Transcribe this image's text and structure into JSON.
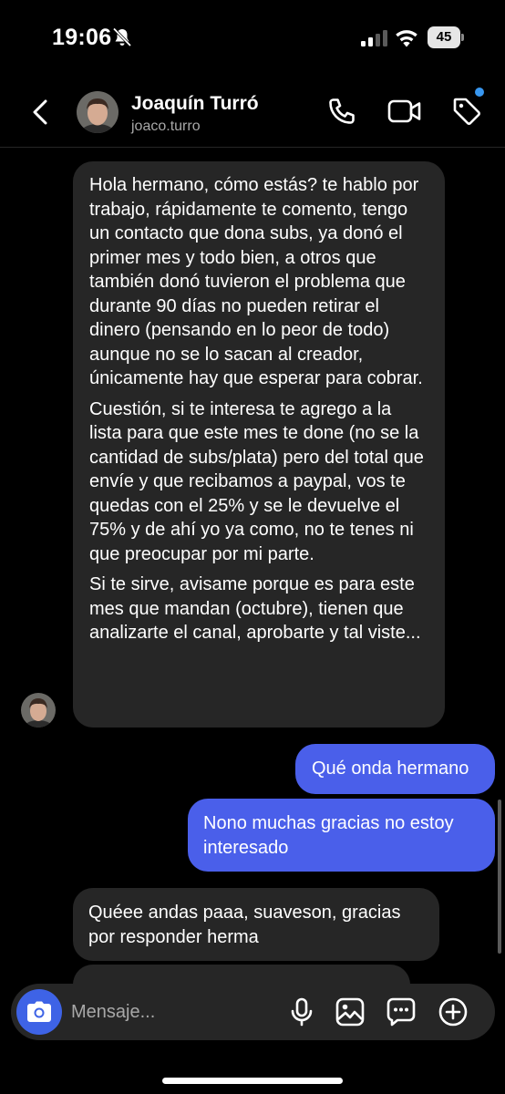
{
  "status_bar": {
    "time": "19:06",
    "battery": "45"
  },
  "header": {
    "contact_name": "Joaquín Turró",
    "username": "joaco.turro"
  },
  "messages": [
    {
      "sender": "Joaquín Turró",
      "direction": "incoming",
      "paragraphs": [
        "Hola hermano, cómo estás? te hablo por trabajo, rápidamente te comento, tengo un contacto que dona subs, ya donó el primer mes y todo bien, a otros que también donó tuvieron el problema que durante 90 días no pueden retirar el dinero (pensando en lo peor de todo) aunque no se lo sacan al creador, únicamente hay que esperar para cobrar.",
        "Cuestión, si te interesa te agrego a la lista para que este mes te done (no se la cantidad de subs/plata) pero del total que envíe y que recibamos a paypal, vos te quedas con el 25% y se le devuelve el 75% y de ahí yo ya como, no te tenes ni que preocupar por mi parte.",
        "Si te sirve, avisame porque es para este mes que mandan (octubre), tienen que analizarte el canal, aprobarte y tal viste..."
      ]
    },
    {
      "direction": "outgoing",
      "text": "Qué onda hermano"
    },
    {
      "direction": "outgoing",
      "text": "Nono muchas gracias no estoy interesado"
    },
    {
      "direction": "incoming",
      "text": "Quéee andas paaa, suaveson, gracias por responder herma"
    }
  ],
  "composer": {
    "placeholder": "Mensaje..."
  },
  "colors": {
    "background": "#000000",
    "incoming_bubble": "#262626",
    "outgoing_bubble": "#4a5fea",
    "camera_button": "#3e63e6",
    "notification_dot": "#3897f0"
  },
  "icons": {
    "status": [
      "bell-off-icon",
      "signal-icon",
      "wifi-icon",
      "battery-icon"
    ],
    "header": [
      "back-chevron-icon",
      "phone-icon",
      "video-camera-icon",
      "tag-icon"
    ],
    "composer": [
      "camera-icon",
      "microphone-icon",
      "gallery-icon",
      "sticker-chat-icon",
      "plus-icon"
    ]
  }
}
